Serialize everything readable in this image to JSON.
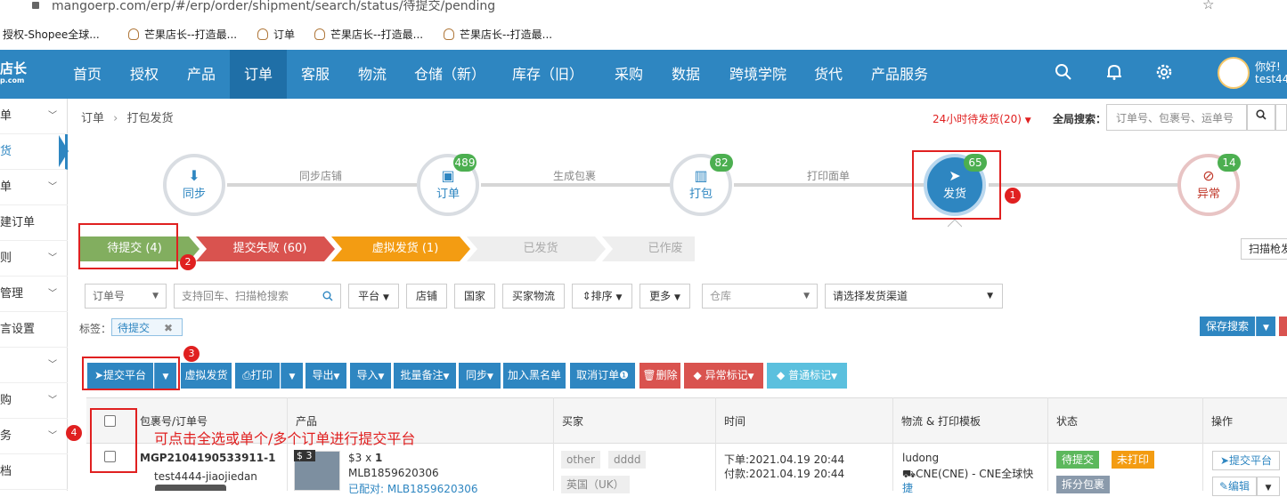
{
  "browser": {
    "url": "mangoerp.com/erp/#/erp/order/shipment/search/status/待提交/pending",
    "bookmarks": [
      "授权-Shopee全球...",
      "芒果店长--打造最...",
      "订单",
      "芒果店长--打造最...",
      "芒果店长--打造最..."
    ]
  },
  "nav": {
    "logo": "店长",
    "logo_sub": "p.com",
    "items": [
      "首页",
      "授权",
      "产品",
      "订单",
      "客服",
      "物流",
      "仓储（新）",
      "库存（旧）",
      "采购",
      "数据",
      "跨境学院",
      "货代",
      "产品服务"
    ],
    "active": "订单",
    "greeting": "你好!",
    "username": "test44"
  },
  "sidebar": {
    "items": [
      "单",
      "货",
      "单",
      "建订单",
      "则",
      "管理",
      "言设置",
      "",
      "购",
      "务",
      "档"
    ]
  },
  "breadcrumb": {
    "root": "订单",
    "sep": "›",
    "current": "打包发货"
  },
  "header": {
    "pending_24h": "24小时待发货(20)",
    "global_search_label": "全局搜索：",
    "global_search_placeholder": "订单号、包裹号、运单号"
  },
  "flow": {
    "steps": [
      {
        "label": "同步",
        "badge": ""
      },
      {
        "label": "订单",
        "badge": "489"
      },
      {
        "label": "打包",
        "badge": "82"
      },
      {
        "label": "发货",
        "badge": "65"
      },
      {
        "label": "异常",
        "badge": "14"
      }
    ],
    "connectors": [
      "同步店铺",
      "生成包裹",
      "打印面单"
    ]
  },
  "status_tabs": [
    "待提交 (4)",
    "提交失败 (60)",
    "虚拟发货 (1)",
    "已发货",
    "已作废"
  ],
  "scan_button": "扫描枪发",
  "filters": {
    "order_select": "订单号",
    "search_placeholder": "支持回车、扫描枪搜索",
    "buttons": [
      "平台",
      "店铺",
      "国家",
      "买家物流",
      "排序",
      "更多"
    ],
    "warehouse": "仓库",
    "channel": "请选择发货渠道",
    "tag_label": "标签：",
    "tag_value": "待提交",
    "save_search": "保存搜索"
  },
  "actions": [
    "提交平台",
    "虚拟发货",
    "打印",
    "导出",
    "导入",
    "批量备注",
    "同步",
    "加入黑名单",
    "取消订单",
    "删除",
    "异常标记",
    "普通标记"
  ],
  "annotations": {
    "n1": "1",
    "n2": "2",
    "n3": "3",
    "n4": "4",
    "hint": "可点击全选或单个/多个订单进行提交平台"
  },
  "table": {
    "headers": [
      "包裹号/订单号",
      "产品",
      "买家",
      "时间",
      "物流 & 打印模板",
      "状态",
      "操作"
    ],
    "row": {
      "package_no": "MGP2104190533911-1",
      "shop": "test4444-jiaojiedan",
      "price_badge": "$ 3",
      "unit_price": "$3",
      "qty_prefix": "x",
      "qty": "1",
      "sku": "MLB1859620306",
      "matched": "已配对: MLB1859620306",
      "buyer_tags": [
        "other",
        "dddd"
      ],
      "country": "英国（UK）",
      "order_time": "下单:2021.04.19 20:44",
      "pay_time": "付款:2021.04.19 20:44",
      "logistics": "ludong",
      "channel": "CNE(CNE) - CNE全球快",
      "channel_line2": "捷",
      "status1": "待提交",
      "status2": "未打印",
      "status3": "拆分包裹",
      "op_submit": "提交平台",
      "op_edit": "编辑"
    }
  },
  "colors": {
    "nav_bg": "#2e86c1",
    "primary": "#2e86c1",
    "success": "#4caf50",
    "danger": "#d9534f",
    "warning": "#f39c12",
    "annotation": "#e02020"
  }
}
